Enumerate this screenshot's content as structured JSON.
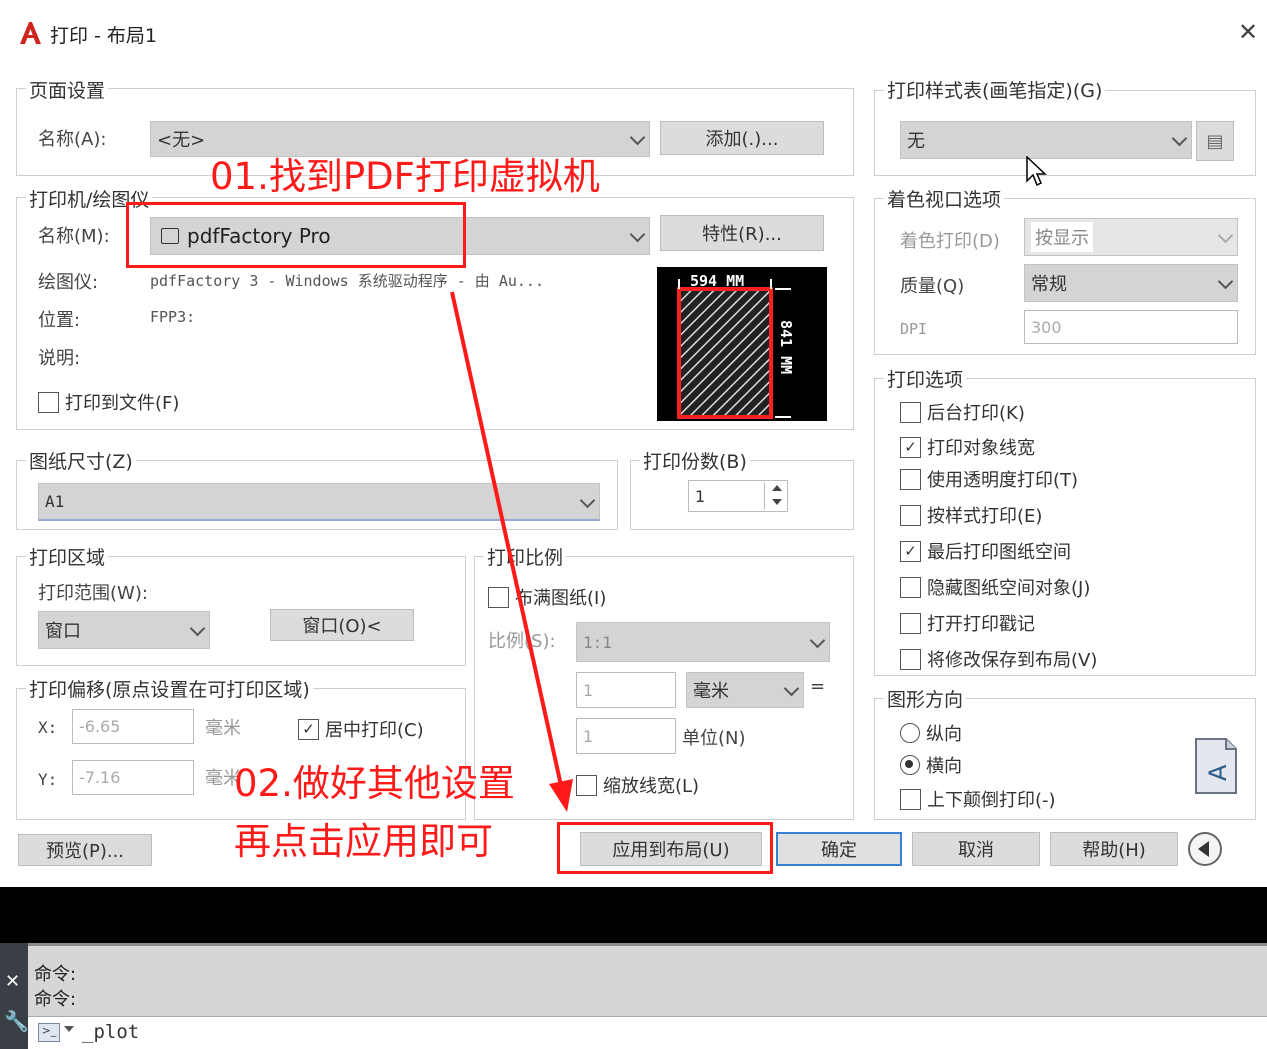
{
  "window": {
    "title": "打印 - 布局1",
    "close": "✕"
  },
  "page_setup": {
    "legend": "页面设置",
    "name_label": "名称(A):",
    "name_value": "<无>",
    "add_button": "添加(.)..."
  },
  "printer": {
    "legend": "打印机/绘图仪",
    "name_label": "名称(M):",
    "name_value": "pdfFactory Pro",
    "properties_button": "特性(R)...",
    "plotter_label": "绘图仪:",
    "plotter_value": "pdfFactory 3 - Windows 系统驱动程序 - 由 Au...",
    "location_label": "位置:",
    "location_value": "FPP3:",
    "description_label": "说明:",
    "print_to_file": "打印到文件(F)",
    "preview_width": "594 MM",
    "preview_height": "841 MM"
  },
  "paper_size": {
    "legend": "图纸尺寸(Z)",
    "value": "A1"
  },
  "copies": {
    "legend": "打印份数(B)",
    "value": "1"
  },
  "plot_area": {
    "legend": "打印区域",
    "range_label": "打印范围(W):",
    "range_value": "窗口",
    "window_button": "窗口(O)<"
  },
  "plot_offset": {
    "legend": "打印偏移(原点设置在可打印区域)",
    "x_label": "X:",
    "x_value": "-6.65",
    "x_unit": "毫米",
    "y_label": "Y:",
    "y_value": "-7.16",
    "y_unit": "毫米",
    "center": "居中打印(C)"
  },
  "plot_scale": {
    "legend": "打印比例",
    "fit": "布满图纸(I)",
    "scale_label": "比例(S):",
    "scale_value": "1:1",
    "value1": "1",
    "unit1": "毫米",
    "equals": "=",
    "value2": "1",
    "unit2": "单位(N)",
    "scale_lineweights": "缩放线宽(L)"
  },
  "plot_style": {
    "legend": "打印样式表(画笔指定)(G)",
    "value": "无"
  },
  "shaded_viewport": {
    "legend": "着色视口选项",
    "shade_label": "着色打印(D)",
    "shade_value": "按显示",
    "quality_label": "质量(Q)",
    "quality_value": "常规",
    "dpi_label": "DPI",
    "dpi_value": "300"
  },
  "plot_options": {
    "legend": "打印选项",
    "items": [
      {
        "label": "后台打印(K)",
        "mark": ""
      },
      {
        "label": "打印对象线宽",
        "mark": "✓"
      },
      {
        "label": "使用透明度打印(T)",
        "mark": ""
      },
      {
        "label": "按样式打印(E)",
        "mark": ""
      },
      {
        "label": "最后打印图纸空间",
        "mark": "✓"
      },
      {
        "label": "隐藏图纸空间对象(J)",
        "mark": ""
      },
      {
        "label": "打开打印戳记",
        "mark": ""
      },
      {
        "label": "将修改保存到布局(V)",
        "mark": ""
      }
    ]
  },
  "orientation": {
    "legend": "图形方向",
    "portrait": "纵向",
    "landscape": "横向",
    "upside_down": "上下颠倒打印(-)",
    "selected": "landscape"
  },
  "buttons": {
    "preview": "预览(P)...",
    "apply": "应用到布局(U)",
    "ok": "确定",
    "cancel": "取消",
    "help": "帮助(H)"
  },
  "annotations": {
    "step1": "01.找到PDF打印虚拟机",
    "step2_line1": "02.做好其他设置",
    "step2_line2": "再点击应用即可"
  },
  "command_line": {
    "history": [
      "命令:",
      "命令:"
    ],
    "input": "_plot"
  },
  "colors": {
    "annotation_red": "#ff1a1a",
    "primary_border": "#3b7fd1"
  }
}
